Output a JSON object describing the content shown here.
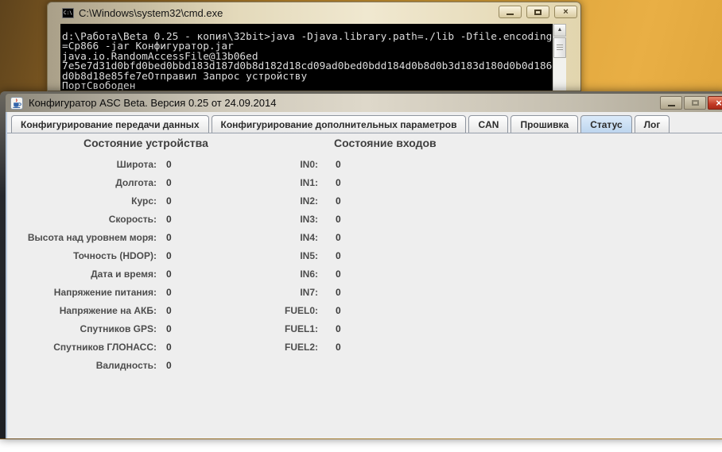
{
  "colors": {
    "desktop_orange": "#daa238",
    "selected_tab_blue": "#c6dcf2",
    "close_button_red": "#c23b26",
    "console_background": "#000000",
    "panel_background": "#eeeeee"
  },
  "glyphs": {
    "close": "×",
    "up_arrow": "▲"
  },
  "cmd_window": {
    "icon_text": "C:\\",
    "title": "C:\\Windows\\system32\\cmd.exe",
    "controls": [
      "minimize",
      "maximize",
      "close"
    ],
    "console_lines": [
      "d:\\Работа\\Beta 0.25 - копия\\32bit>java -Djava.library.path=./lib -Dfile.encoding",
      "=Cp866 -jar Конфигуратор.jar",
      "java.io.RandomAccessFile@13b06ed",
      "7e5e7d31d0bfd0bed0bbd183d187d0b8d182d18cd09ad0bed0bdd184d0b8d0b3d183d180d0b0d186",
      "d0b8d18e85fe7eОтправил Запрос устройству",
      "ПортСвободен"
    ]
  },
  "app_window": {
    "title": "Конфигуратор ASC Beta. Версия 0.25 от 24.09.2014",
    "controls": [
      "minimize",
      "maximize",
      "close"
    ],
    "tabs": [
      {
        "label": "Конфигурирование передачи данных",
        "selected": false
      },
      {
        "label": "Конфигурирование дополнительных параметров",
        "selected": false
      },
      {
        "label": "CAN",
        "selected": false
      },
      {
        "label": "Прошивка",
        "selected": false
      },
      {
        "label": "Статус",
        "selected": true
      },
      {
        "label": "Лог",
        "selected": false
      }
    ],
    "status_panel": {
      "device_header": "Состояние устройства",
      "device_rows": [
        {
          "label": "Широта:",
          "value": "0"
        },
        {
          "label": "Долгота:",
          "value": "0"
        },
        {
          "label": "Курс:",
          "value": "0"
        },
        {
          "label": "Скорость:",
          "value": "0"
        },
        {
          "label": "Высота над уровнем моря:",
          "value": "0"
        },
        {
          "label": "Точность (HDOP):",
          "value": "0"
        },
        {
          "label": "Дата и время:",
          "value": "0"
        },
        {
          "label": "Напряжение питания:",
          "value": "0"
        },
        {
          "label": "Напряжение на АКБ:",
          "value": "0"
        },
        {
          "label": "Спутников GPS:",
          "value": "0"
        },
        {
          "label": "Спутников ГЛОНАСС:",
          "value": "0"
        },
        {
          "label": "Валидность:",
          "value": "0"
        }
      ],
      "inputs_header": "Состояние входов",
      "input_rows": [
        {
          "label": "IN0:",
          "value": "0"
        },
        {
          "label": "IN1:",
          "value": "0"
        },
        {
          "label": "IN2:",
          "value": "0"
        },
        {
          "label": "IN3:",
          "value": "0"
        },
        {
          "label": "IN4:",
          "value": "0"
        },
        {
          "label": "IN5:",
          "value": "0"
        },
        {
          "label": "IN6:",
          "value": "0"
        },
        {
          "label": "IN7:",
          "value": "0"
        },
        {
          "label": "FUEL0:",
          "value": "0"
        },
        {
          "label": "FUEL1:",
          "value": "0"
        },
        {
          "label": "FUEL2:",
          "value": "0"
        }
      ]
    }
  }
}
